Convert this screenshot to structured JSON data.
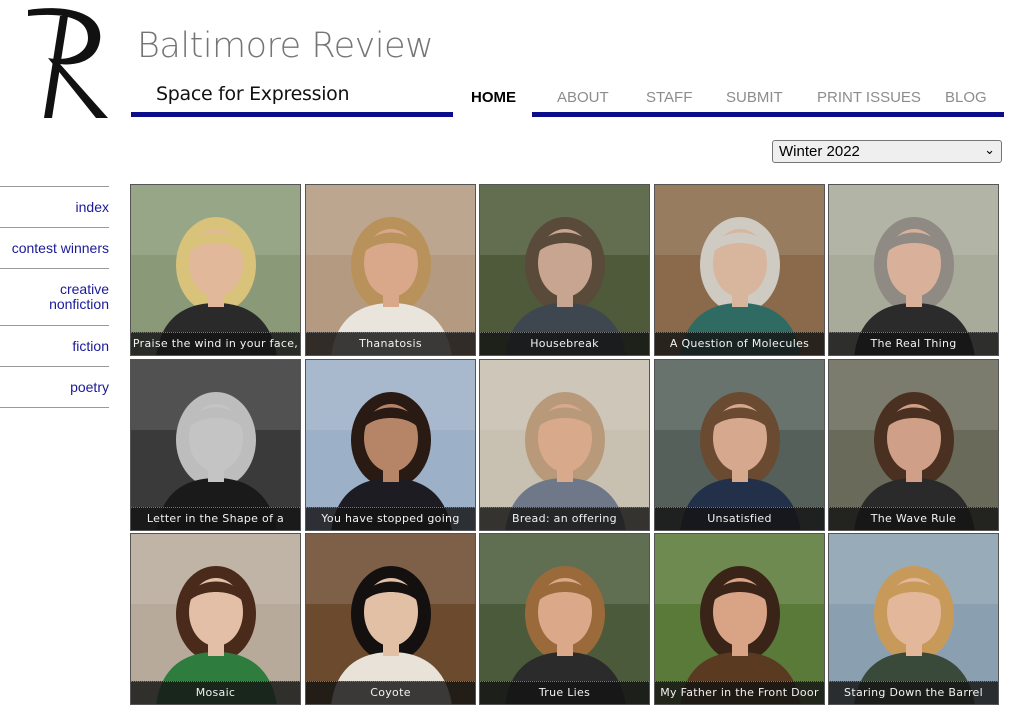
{
  "site": {
    "title": "Baltimore Review",
    "tagline": "Space for Expression"
  },
  "nav": [
    {
      "label": "HOME",
      "active": true
    },
    {
      "label": "ABOUT",
      "active": false
    },
    {
      "label": "STAFF",
      "active": false
    },
    {
      "label": "SUBMIT",
      "active": false
    },
    {
      "label": "PRINT ISSUES",
      "active": false
    },
    {
      "label": "BLOG",
      "active": false
    }
  ],
  "issue_select": {
    "value": "Winter 2022"
  },
  "sidebar": [
    {
      "label": "index"
    },
    {
      "label": "contest winners"
    },
    {
      "label": "creative nonfiction"
    },
    {
      "label": "fiction"
    },
    {
      "label": "poetry"
    }
  ],
  "tiles": [
    {
      "caption": "Praise the wind in your face,",
      "bg": "#8a9a78",
      "hair": "#d9c27a",
      "skin": "#e2b89a",
      "shirt": "#2a2a2a"
    },
    {
      "caption": "Thanatosis",
      "bg": "#b49a80",
      "hair": "#b8925a",
      "skin": "#d9a88a",
      "shirt": "#e9e4dc"
    },
    {
      "caption": "Housebreak",
      "bg": "#4e5a3a",
      "hair": "#5a4a3a",
      "skin": "#c8a590",
      "shirt": "#3e4650"
    },
    {
      "caption": "A Question of Molecules",
      "bg": "#8a6a4a",
      "hair": "#cfcac2",
      "skin": "#d8b59d",
      "shirt": "#2f6a63"
    },
    {
      "caption": "The Real Thing",
      "bg": "#a8aa9a",
      "hair": "#8f8a84",
      "skin": "#d9b19b",
      "shirt": "#2b2b2b"
    },
    {
      "caption": "Letter in the Shape of a",
      "bg": "#3a3a3a",
      "hair": "#bdbdbd",
      "skin": "#c4c4c4",
      "shirt": "#1a1a1a"
    },
    {
      "caption": "You have stopped going",
      "bg": "#9cb0c8",
      "hair": "#2a1a14",
      "skin": "#b68466",
      "shirt": "#1c1c22"
    },
    {
      "caption": "Bread: an offering",
      "bg": "#c8c0b0",
      "hair": "#b89a7a",
      "skin": "#d9a98c",
      "shirt": "#6f7888"
    },
    {
      "caption": "Unsatisfied",
      "bg": "#55605a",
      "hair": "#6a4a30",
      "skin": "#d6a98e",
      "shirt": "#23304a"
    },
    {
      "caption": "The Wave Rule",
      "bg": "#6a6a5a",
      "hair": "#4a3020",
      "skin": "#cfa087",
      "shirt": "#2a2a2a"
    },
    {
      "caption": "Mosaic",
      "bg": "#b8aa9a",
      "hair": "#4a2a1a",
      "skin": "#e3bfa8",
      "shirt": "#2e7d3e"
    },
    {
      "caption": "Coyote",
      "bg": "#6b4a2e",
      "hair": "#141010",
      "skin": "#e2c0a6",
      "shirt": "#e8e2d8"
    },
    {
      "caption": "True Lies",
      "bg": "#4a5a3a",
      "hair": "#9a6a3a",
      "skin": "#dba889",
      "shirt": "#2b2b2b"
    },
    {
      "caption": "My Father in the Front Door",
      "bg": "#5a7a3a",
      "hair": "#3a2418",
      "skin": "#d9a486",
      "shirt": "#5a3a20"
    },
    {
      "caption": "Staring Down the Barrel",
      "bg": "#8aa0b0",
      "hair": "#c89a5a",
      "skin": "#e3b79a",
      "shirt": "#3a4a3a"
    }
  ]
}
